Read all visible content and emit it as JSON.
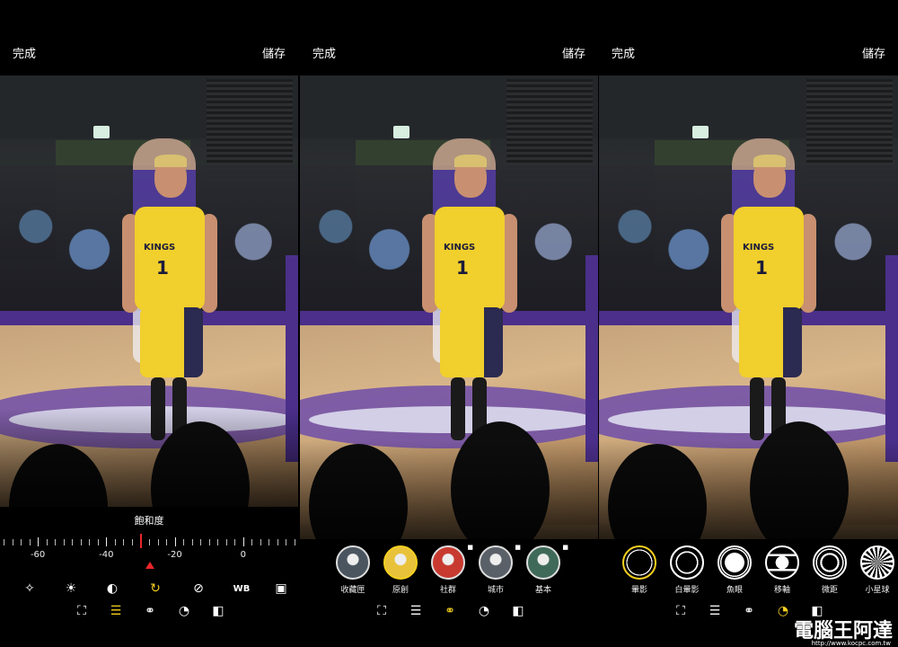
{
  "panels": [
    {
      "done_label": "完成",
      "save_label": "儲存"
    },
    {
      "done_label": "完成",
      "save_label": "儲存"
    },
    {
      "done_label": "完成",
      "save_label": "儲存"
    }
  ],
  "photo": {
    "jersey_text": "KINGS",
    "jersey_number": "1"
  },
  "adjust": {
    "label": "飽和度",
    "scale_labels": [
      "-60",
      "-40",
      "-20",
      "0"
    ],
    "value": -30,
    "min": -70,
    "max": 15,
    "tools": [
      {
        "icon": "magic-wand-icon",
        "glyph": "✧"
      },
      {
        "icon": "brightness-icon",
        "glyph": "☀"
      },
      {
        "icon": "contrast-icon",
        "glyph": "◐"
      },
      {
        "icon": "saturation-icon",
        "glyph": "↻",
        "active": true
      },
      {
        "icon": "tone-icon",
        "glyph": "⊘"
      },
      {
        "icon": "white-balance-icon",
        "glyph": "WB"
      },
      {
        "icon": "vignette-box-icon",
        "glyph": "▣"
      }
    ]
  },
  "bottom_tools": [
    {
      "icon": "crop-icon",
      "glyph": "⛶"
    },
    {
      "icon": "adjust-sliders-icon",
      "glyph": "☰"
    },
    {
      "icon": "filters-icon",
      "glyph": "⚭"
    },
    {
      "icon": "lens-effect-icon",
      "glyph": "◔"
    },
    {
      "icon": "compare-icon",
      "glyph": "◧"
    }
  ],
  "bottom_tools_active": [
    1,
    2,
    3
  ],
  "presets": [
    {
      "label": "收藏匣",
      "color": "#4a5560",
      "locked": false,
      "selected": false
    },
    {
      "label": "原創",
      "color": "#e8c23a",
      "locked": false,
      "selected": true
    },
    {
      "label": "社群",
      "color": "#c83a30",
      "locked": true,
      "selected": false
    },
    {
      "label": "城市",
      "color": "#5a6068",
      "locked": true,
      "selected": false
    },
    {
      "label": "基本",
      "color": "#3f6a5a",
      "locked": true,
      "selected": false
    }
  ],
  "effects": [
    {
      "label": "暈影",
      "selected": true
    },
    {
      "label": "白暈影",
      "selected": false
    },
    {
      "label": "魚眼",
      "selected": false
    },
    {
      "label": "移軸",
      "selected": false
    },
    {
      "label": "微距",
      "selected": false
    },
    {
      "label": "小星球",
      "selected": false
    }
  ],
  "watermark": {
    "text": "電腦王阿達",
    "url": "http://www.kocpc.com.tw"
  }
}
